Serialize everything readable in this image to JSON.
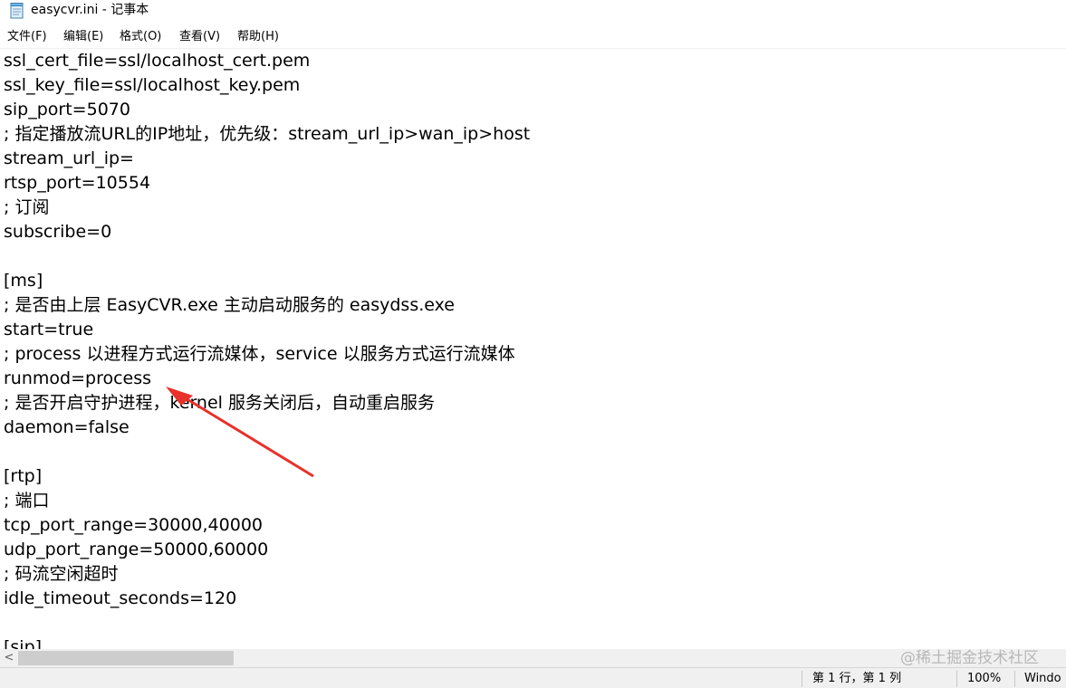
{
  "window": {
    "title": "easycvr.ini - 记事本",
    "icon": "notepad-icon"
  },
  "menu": {
    "items": [
      "文件(F)",
      "编辑(E)",
      "格式(O)",
      "查看(V)",
      "帮助(H)"
    ]
  },
  "editor": {
    "lines": [
      "ssl_cert_file=ssl/localhost_cert.pem",
      "ssl_key_file=ssl/localhost_key.pem",
      "sip_port=5070",
      "; 指定播放流URL的IP地址，优先级：stream_url_ip>wan_ip>host",
      "stream_url_ip=",
      "rtsp_port=10554",
      "; 订阅",
      "subscribe=0",
      "",
      "[ms]",
      "; 是否由上层 EasyCVR.exe 主动启动服务的 easydss.exe",
      "start=true",
      "; process 以进程方式运行流媒体，service 以服务方式运行流媒体",
      "runmod=process",
      "; 是否开启守护进程，kernel 服务关闭后，自动重启服务",
      "daemon=false",
      "",
      "[rtp]",
      "; 端口",
      "tcp_port_range=30000,40000",
      "udp_port_range=50000,60000",
      "; 码流空闲超时",
      "idle_timeout_seconds=120",
      "",
      "[sip]"
    ]
  },
  "annotation": {
    "color": "#e8312a"
  },
  "scrollbar": {
    "left_arrow": "<"
  },
  "watermark": "@稀土掘金技术社区",
  "status": {
    "position": "第 1 行，第 1 列",
    "zoom": "100%",
    "line_ending": "Windo"
  }
}
